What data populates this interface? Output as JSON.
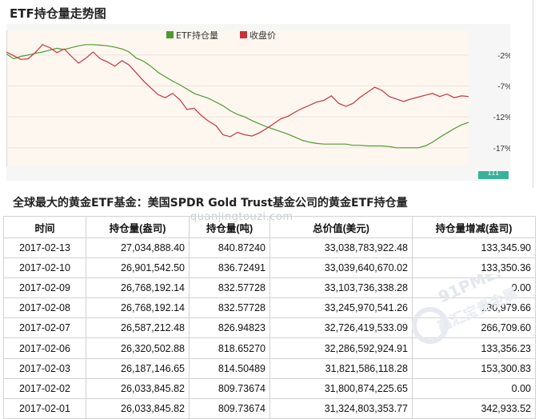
{
  "panel": {
    "title": "ETF持仓量走势图"
  },
  "pager_label": "III",
  "chart_data": {
    "type": "line",
    "series": [
      {
        "name": "ETF持仓量",
        "color": "#4f9a2f",
        "values": [
          -1.8,
          -2.6,
          -2.2,
          -2.0,
          -1.7,
          -1.5,
          -1.2,
          -0.9,
          -1.1,
          -0.8,
          -0.5,
          -0.3,
          -0.3,
          -0.4,
          -0.5,
          -0.7,
          -1.0,
          -1.5,
          -2.5,
          -3.0,
          -3.8,
          -4.8,
          -5.5,
          -6.2,
          -6.8,
          -7.5,
          -8.2,
          -8.6,
          -9.0,
          -9.6,
          -10.2,
          -11.0,
          -11.6,
          -12.0,
          -12.6,
          -13.1,
          -13.6,
          -14.0,
          -14.4,
          -14.8,
          -15.3,
          -15.8,
          -16.1,
          -16.3,
          -16.4,
          -16.4,
          -16.4,
          -16.4,
          -16.6,
          -16.6,
          -16.7,
          -16.7,
          -16.7,
          -16.8,
          -17.0,
          -17.0,
          -17.0,
          -17.0,
          -16.7,
          -16.1,
          -15.3,
          -14.6,
          -13.9,
          -13.3,
          -12.9
        ]
      },
      {
        "name": "收盘价",
        "color": "#c8323c",
        "values": [
          -1.5,
          -2.1,
          -2.7,
          -2.6,
          -1.6,
          -0.3,
          -0.8,
          -1.6,
          -1.0,
          -2.2,
          -3.3,
          -2.5,
          -1.5,
          -2.6,
          -3.1,
          -3.8,
          -2.9,
          -3.6,
          -4.9,
          -6.2,
          -7.3,
          -8.4,
          -8.9,
          -8.2,
          -9.2,
          -10.8,
          -10.6,
          -11.8,
          -12.7,
          -13.4,
          -14.9,
          -15.2,
          -14.5,
          -14.9,
          -15.1,
          -14.6,
          -13.9,
          -13.1,
          -12.3,
          -11.9,
          -11.2,
          -10.6,
          -10.1,
          -9.6,
          -9.3,
          -8.6,
          -9.8,
          -10.3,
          -9.8,
          -8.8,
          -8.0,
          -7.2,
          -7.7,
          -8.7,
          -9.1,
          -9.5,
          -9.1,
          -8.8,
          -8.5,
          -8.2,
          -8.7,
          -8.3,
          -8.9,
          -8.6,
          -8.7
        ]
      }
    ],
    "ylim": [
      -20,
      2
    ],
    "yticks": [
      "-2%",
      "-7%",
      "-12%",
      "-17%"
    ],
    "ytick_values": [
      -2,
      -7,
      -12,
      -17
    ],
    "grid": true,
    "legend": "top-center"
  },
  "table": {
    "title": "全球最大的黄金ETF基金：美国SPDR Gold Trust基金公司的黄金ETF持仓量",
    "headers": [
      "时间",
      "持仓量(盎司)",
      "持仓量(吨)",
      "总价值(美元)",
      "持仓量增减(盎司)"
    ],
    "rows": [
      [
        "2017-02-13",
        "27,034,888.40",
        "840.87240",
        "33,038,783,922.48",
        "133,345.90"
      ],
      [
        "2017-02-10",
        "26,901,542.50",
        "836.72491",
        "33,039,640,670.02",
        "133,350.36"
      ],
      [
        "2017-02-09",
        "26,768,192.14",
        "832.57728",
        "33,103,736,338.28",
        "0.00"
      ],
      [
        "2017-02-08",
        "26,768,192.14",
        "832.57728",
        "33,245,970,541.26",
        "180,979.66"
      ],
      [
        "2017-02-07",
        "26,587,212.48",
        "826.94823",
        "32,726,419,533.09",
        "266,709.60"
      ],
      [
        "2017-02-06",
        "26,320,502.88",
        "818.65270",
        "32,286,592,924.91",
        "133,356.23"
      ],
      [
        "2017-02-03",
        "26,187,146.65",
        "814.50489",
        "31,821,586,118.28",
        "153,300.83"
      ],
      [
        "2017-02-02",
        "26,033,845.82",
        "809.73674",
        "31,800,874,225.65",
        "0.00"
      ],
      [
        "2017-02-01",
        "26,033,845.82",
        "809.73674",
        "31,324,803,353.77",
        "342,933.52"
      ]
    ]
  },
  "watermark": {
    "text": "quanjingtouzi.com",
    "site": "91PME.COM",
    "cn": "鑫汇宝贵金属"
  }
}
